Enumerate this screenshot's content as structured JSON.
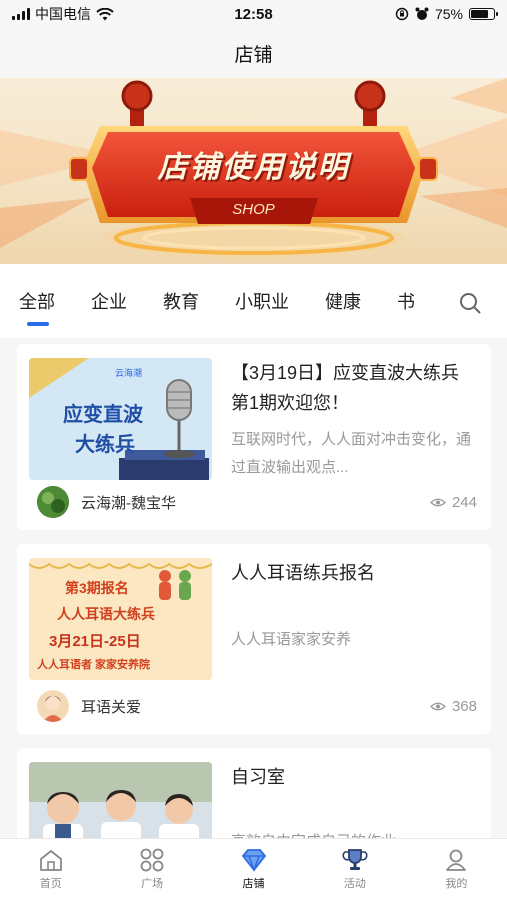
{
  "status": {
    "carrier": "中国电信",
    "time": "12:58",
    "battery": "75%",
    "battery_level": 0.75
  },
  "header": {
    "title": "店铺"
  },
  "banner": {
    "title": "店铺使用说明",
    "subtitle": "SHOP",
    "colors": {
      "red": "#e23a1e",
      "gold": "#f6b544",
      "cream": "#f4e4c6"
    }
  },
  "tabs": [
    {
      "label": "全部",
      "active": true
    },
    {
      "label": "企业"
    },
    {
      "label": "教育"
    },
    {
      "label": "小职业"
    },
    {
      "label": "健康"
    },
    {
      "label": "书"
    }
  ],
  "cards": [
    {
      "title": "【3月19日】应变直波大练兵第1期欢迎您！",
      "desc": "互联网时代，人人面对冲击变化，通过直波输出观点...",
      "author": "云海潮-魏宝华",
      "views": "244",
      "thumb": {
        "brand": "云海潮",
        "line1": "应变直波",
        "line2": "大练兵"
      }
    },
    {
      "title": "人人耳语练兵报名",
      "desc": "人人耳语家家安养",
      "author": "耳语关爱",
      "views": "368",
      "thumb": {
        "line1": "第3期报名",
        "line2": "人人耳语大练兵",
        "line3": "3月21日-25日",
        "line4": "人人耳语者 家家安养院"
      }
    },
    {
      "title": "自习室",
      "desc": "高效自由完成自己的作业",
      "author": "",
      "views": ""
    }
  ],
  "tabbar": [
    {
      "label": "首页",
      "icon": "home-icon"
    },
    {
      "label": "广场",
      "icon": "grid-icon"
    },
    {
      "label": "店铺",
      "icon": "diamond-icon",
      "active": true
    },
    {
      "label": "活动",
      "icon": "trophy-icon"
    },
    {
      "label": "我的",
      "icon": "user-icon"
    }
  ],
  "accent": "#2b6be6"
}
